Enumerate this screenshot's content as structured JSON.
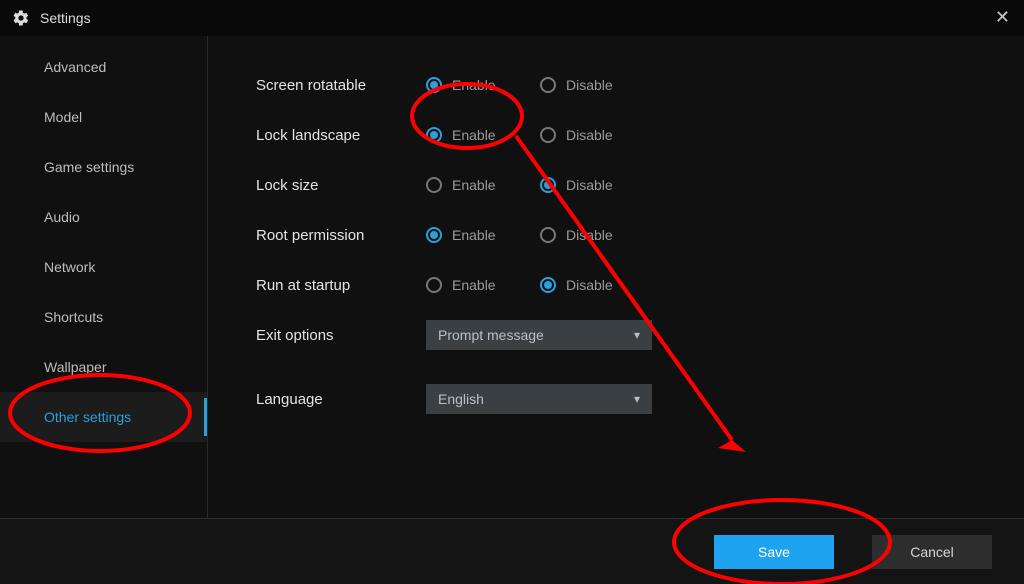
{
  "header": {
    "title": "Settings"
  },
  "sidebar": {
    "items": [
      {
        "label": "Advanced"
      },
      {
        "label": "Model"
      },
      {
        "label": "Game settings"
      },
      {
        "label": "Audio"
      },
      {
        "label": "Network"
      },
      {
        "label": "Shortcuts"
      },
      {
        "label": "Wallpaper"
      },
      {
        "label": "Other settings"
      }
    ],
    "active_index": 7
  },
  "settings": {
    "radio_labels": {
      "enable": "Enable",
      "disable": "Disable"
    },
    "rows": [
      {
        "key": "screen_rotatable",
        "label": "Screen rotatable",
        "value": "enable"
      },
      {
        "key": "lock_landscape",
        "label": "Lock landscape",
        "value": "enable"
      },
      {
        "key": "lock_size",
        "label": "Lock size",
        "value": "disable"
      },
      {
        "key": "root_permission",
        "label": "Root permission",
        "value": "enable"
      },
      {
        "key": "run_at_startup",
        "label": "Run at startup",
        "value": "disable"
      }
    ],
    "selects": {
      "exit_options": {
        "label": "Exit options",
        "value": "Prompt message"
      },
      "language": {
        "label": "Language",
        "value": "English"
      }
    }
  },
  "footer": {
    "save": "Save",
    "cancel": "Cancel"
  }
}
